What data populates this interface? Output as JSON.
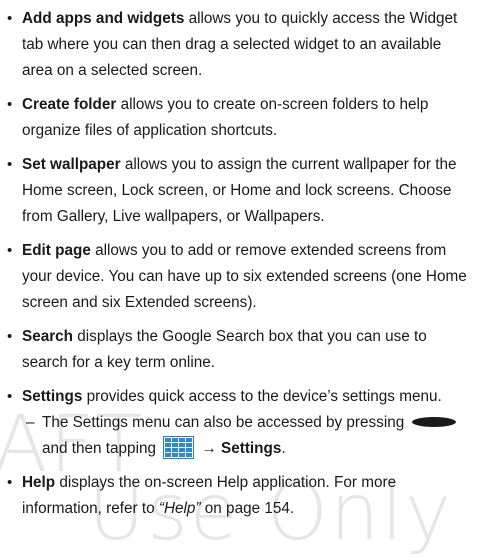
{
  "watermark": {
    "line1": "AFT",
    "line2": "Use Only"
  },
  "items": [
    {
      "term": "Add apps and widgets",
      "text": " allows you to quickly access the Widget tab where you can then drag a selected widget to an available area on a selected screen."
    },
    {
      "term": "Create folder",
      "text": " allows you to create on-screen folders to help organize files of application shortcuts."
    },
    {
      "term": "Set wallpaper",
      "text": " allows you to assign the current wallpaper for the Home screen, Lock screen, or Home and lock screens. Choose from Gallery, Live wallpapers, or Wallpapers."
    },
    {
      "term": "Edit page",
      "text": " allows you to add or remove extended screens from your device. You can have up to six extended screens (one Home screen and six Extended screens)."
    },
    {
      "term": "Search",
      "text": " displays the Google Search box that you can use to search for a key term online."
    },
    {
      "term": "Settings",
      "text": " provides quick access to the device’s settings menu."
    }
  ],
  "subitem": {
    "dash": "–",
    "text1": "The Settings menu can also be accessed by pressing",
    "text2": "and then tapping",
    "arrow": "→",
    "target": "Settings",
    "period": ".",
    "home_key_icon": "home-key-icon",
    "apps_icon": "apps-grid-icon"
  },
  "help": {
    "term": "Help",
    "text": " displays the on-screen Help application. For more information, refer to ",
    "link": "“Help”",
    "tail": " on page 154."
  },
  "bullet": "•"
}
